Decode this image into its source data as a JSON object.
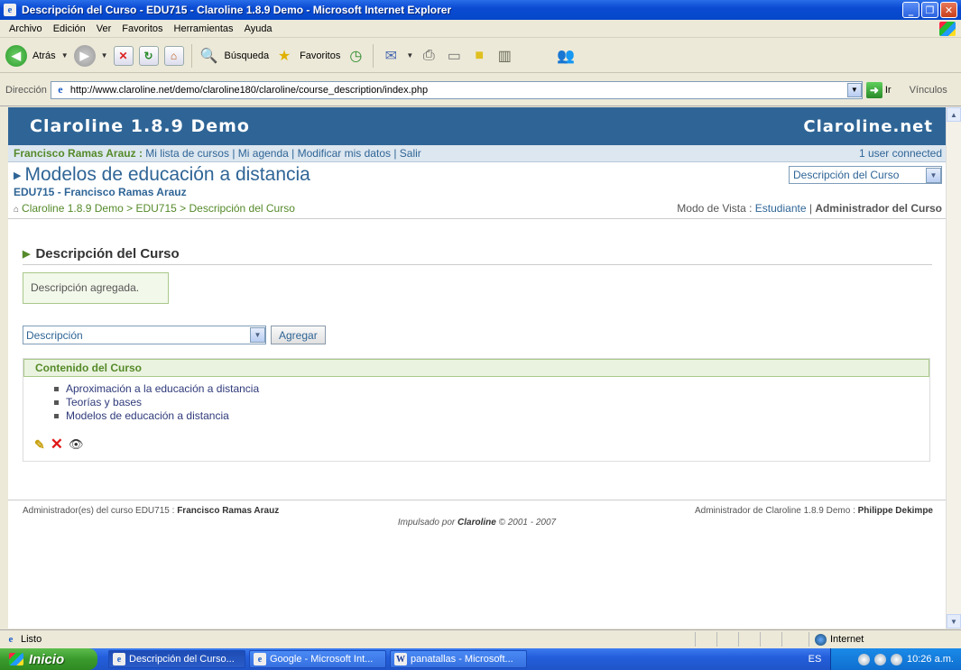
{
  "window": {
    "title": "Descripción del Curso - EDU715 - Claroline 1.8.9 Demo - Microsoft Internet Explorer"
  },
  "menu": [
    "Archivo",
    "Edición",
    "Ver",
    "Favoritos",
    "Herramientas",
    "Ayuda"
  ],
  "toolbar": {
    "back_label": "Atrás",
    "search_label": "Búsqueda",
    "favorites_label": "Favoritos"
  },
  "address": {
    "label": "Dirección",
    "url": "http://www.claroline.net/demo/claroline180/claroline/course_description/index.php",
    "go_label": "Ir",
    "links_label": "Vínculos"
  },
  "page": {
    "site_name": "Claroline 1.8.9 Demo",
    "institution": "Claroline.net",
    "user_name": "Francisco Ramas Arauz",
    "user_sep": " : ",
    "user_links": [
      "Mi lista de cursos",
      "Mi agenda",
      "Modificar mis datos",
      "Salir"
    ],
    "users_connected": "1 user connected",
    "course_title": "Modelos de educación a distancia",
    "course_sub": "EDU715 - Francisco Ramas Arauz",
    "tool_select": "Descripción del Curso",
    "breadcrumb": [
      "Claroline 1.8.9 Demo",
      "EDU715",
      "Descripción del Curso"
    ],
    "view_mode_label": "Modo de Vista : ",
    "view_student": "Estudiante",
    "view_admin": "Administrador del Curso",
    "section_title": "Descripción del Curso",
    "message": "Descripción agregada.",
    "type_select": "Descripción",
    "add_button": "Agregar",
    "content_header": "Contenido del Curso",
    "content_items": [
      "Aproximación a la educación a distancia",
      "Teorías y bases",
      "Modelos de educación a distancia"
    ],
    "footer_left_label": "Administrador(es) del curso EDU715 : ",
    "footer_left_name": "Francisco Ramas Arauz",
    "footer_right_label": "Administrador de Claroline 1.8.9 Demo : ",
    "footer_right_name": "Philippe Dekimpe",
    "footer_center_prefix": "Impulsado por ",
    "footer_center_brand": "Claroline",
    "footer_center_suffix": " © 2001 - 2007"
  },
  "status": {
    "text": "Listo",
    "zone": "Internet"
  },
  "taskbar": {
    "start_label": "Inicio",
    "tasks": [
      "Descripción del Curso...",
      "Google - Microsoft Int...",
      "panatallas - Microsoft..."
    ],
    "lang": "ES",
    "clock": "10:26 a.m."
  },
  "colors": {
    "banner": "#2f6596",
    "accent_green": "#558a2a",
    "link_blue": "#2f6596"
  }
}
